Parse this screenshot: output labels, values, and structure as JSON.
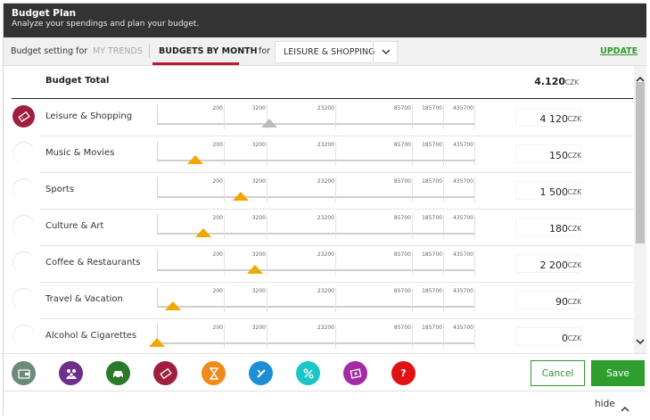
{
  "header": {
    "title": "Budget Plan",
    "subtitle": "Analyze your spendings and plan your budget."
  },
  "tabbar": {
    "setting_label": "Budget setting for",
    "tab_trends": "MY TRENDS",
    "tab_month": "BUDGETS BY MONTH",
    "for_label": "for",
    "category_select": "LEISURE & SHOPPING",
    "update_label": "UPDATE"
  },
  "budget_total": {
    "label": "Budget Total",
    "amount": "4.120",
    "currency": "CZK"
  },
  "slider_ticks": [
    "200",
    "3200",
    "23200",
    "85700",
    "185700",
    "435700"
  ],
  "rows": [
    {
      "label": "Leisure & Shopping",
      "amount": "4 120",
      "currency": "CZK",
      "level": 0.355,
      "active": true
    },
    {
      "label": "Music & Movies",
      "amount": "150",
      "currency": "CZK",
      "level": 0.12,
      "active": false
    },
    {
      "label": "Sports",
      "amount": "1 500",
      "currency": "CZK",
      "level": 0.265,
      "active": false
    },
    {
      "label": "Culture & Art",
      "amount": "180",
      "currency": "CZK",
      "level": 0.147,
      "active": false
    },
    {
      "label": "Coffee & Restaurants",
      "amount": "2 200",
      "currency": "CZK",
      "level": 0.31,
      "active": false
    },
    {
      "label": "Travel & Vacation",
      "amount": "90",
      "currency": "CZK",
      "level": 0.05,
      "active": false
    },
    {
      "label": "Alcohol & Cigarettes",
      "amount": "0",
      "currency": "CZK",
      "level": 0.0,
      "active": false
    }
  ],
  "footer": {
    "help_glyph": "?",
    "cancel_label": "Cancel",
    "save_label": "Save",
    "hide_label": "hide"
  },
  "colors": {
    "header_bg": "#333333",
    "accent_red": "#c0152f",
    "marker_orange": "#f2a600",
    "green": "#2e9f2e",
    "icon_wallet": "#6d8a78",
    "icon_family": "#6f2d8c",
    "icon_car": "#2a7a2a",
    "icon_ticket": "#a01f3c",
    "icon_hourglass": "#f08a1c",
    "icon_tools": "#1e8fd6",
    "icon_percent": "#1bc6c6",
    "icon_photo": "#a52aa6",
    "icon_help": "#e31212"
  }
}
